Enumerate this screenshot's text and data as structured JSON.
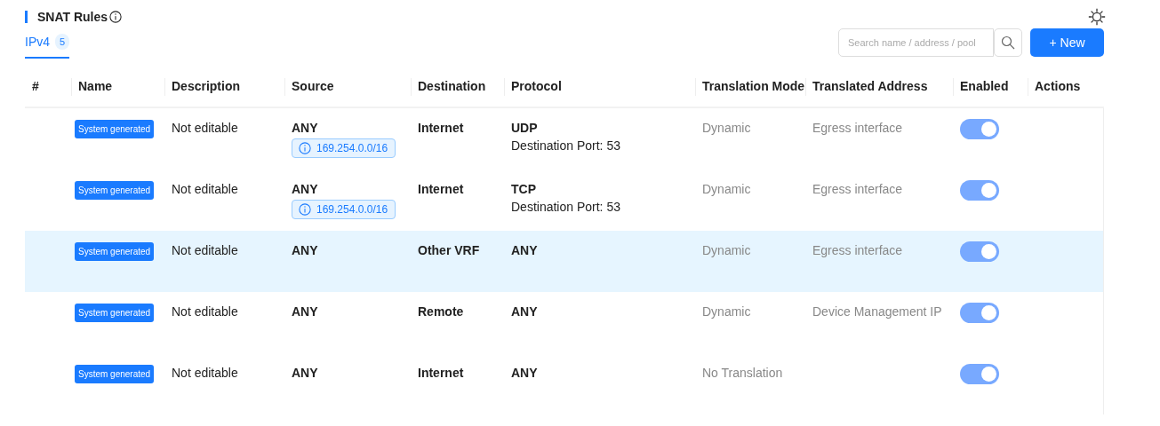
{
  "title": "SNAT Rules",
  "tabs": [
    {
      "label": "IPv4",
      "count": "5",
      "selected": true
    }
  ],
  "search": {
    "placeholder": "Search name / address / pool"
  },
  "new_button": "+ New",
  "table": {
    "columns": [
      "#",
      "Name",
      "Description",
      "Source",
      "Destination",
      "Protocol",
      "Translation Mode",
      "Translated Address",
      "Enabled",
      "Actions"
    ],
    "rows": [
      {
        "name": "System generated",
        "description": "Not editable",
        "source": "ANY",
        "source_tag": "169.254.0.0/16",
        "destination": "Internet",
        "protocol": "UDP",
        "protocol_detail": "Destination Port: 53",
        "mode": "Dynamic",
        "address": "Egress interface",
        "enabled": true,
        "highlighted": false
      },
      {
        "name": "System generated",
        "description": "Not editable",
        "source": "ANY",
        "source_tag": "169.254.0.0/16",
        "destination": "Internet",
        "protocol": "TCP",
        "protocol_detail": "Destination Port: 53",
        "mode": "Dynamic",
        "address": "Egress interface",
        "enabled": true,
        "highlighted": false
      },
      {
        "name": "System generated",
        "description": "Not editable",
        "source": "ANY",
        "destination": "Other VRF",
        "protocol": "ANY",
        "mode": "Dynamic",
        "address": "Egress interface",
        "enabled": true,
        "highlighted": true
      },
      {
        "name": "System generated",
        "description": "Not editable",
        "source": "ANY",
        "destination": "Remote",
        "protocol": "ANY",
        "mode": "Dynamic",
        "address": "Device Management IP",
        "enabled": true,
        "highlighted": false
      },
      {
        "name": "System generated",
        "description": "Not editable",
        "source": "ANY",
        "destination": "Internet",
        "protocol": "ANY",
        "mode": "No Translation",
        "enabled": true,
        "highlighted": false
      }
    ]
  }
}
